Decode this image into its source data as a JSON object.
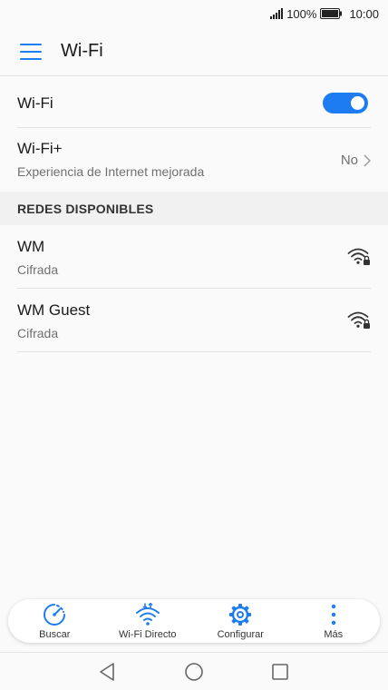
{
  "status_bar": {
    "battery": "100%",
    "time": "10:00",
    "icons": [
      "signal-icon",
      "battery-icon"
    ]
  },
  "app_bar": {
    "title": "Wi-Fi",
    "menu_icon": "hamburger-menu-icon"
  },
  "wifi_toggle": {
    "label": "Wi-Fi",
    "enabled": true
  },
  "wifi_plus": {
    "label": "Wi-Fi+",
    "subtitle": "Experiencia de Internet mejorada",
    "value": "No"
  },
  "available_networks": {
    "header": "REDES DISPONIBLES",
    "items": [
      {
        "name": "WM",
        "security": "Cifrada",
        "icon": "wifi-locked-icon"
      },
      {
        "name": "WM Guest",
        "security": "Cifrada",
        "icon": "wifi-locked-icon"
      }
    ]
  },
  "bottom_actions": [
    {
      "label": "Buscar",
      "icon": "scan-icon"
    },
    {
      "label": "Wi-Fi Directo",
      "icon": "wifi-direct-icon"
    },
    {
      "label": "Configurar",
      "icon": "gear-icon"
    },
    {
      "label": "Más",
      "icon": "more-vertical-icon"
    }
  ],
  "colors": {
    "accent": "#1e7cf2",
    "background": "#fafafa",
    "section_bg": "#f1f1f1",
    "secondary_text": "#707070"
  }
}
